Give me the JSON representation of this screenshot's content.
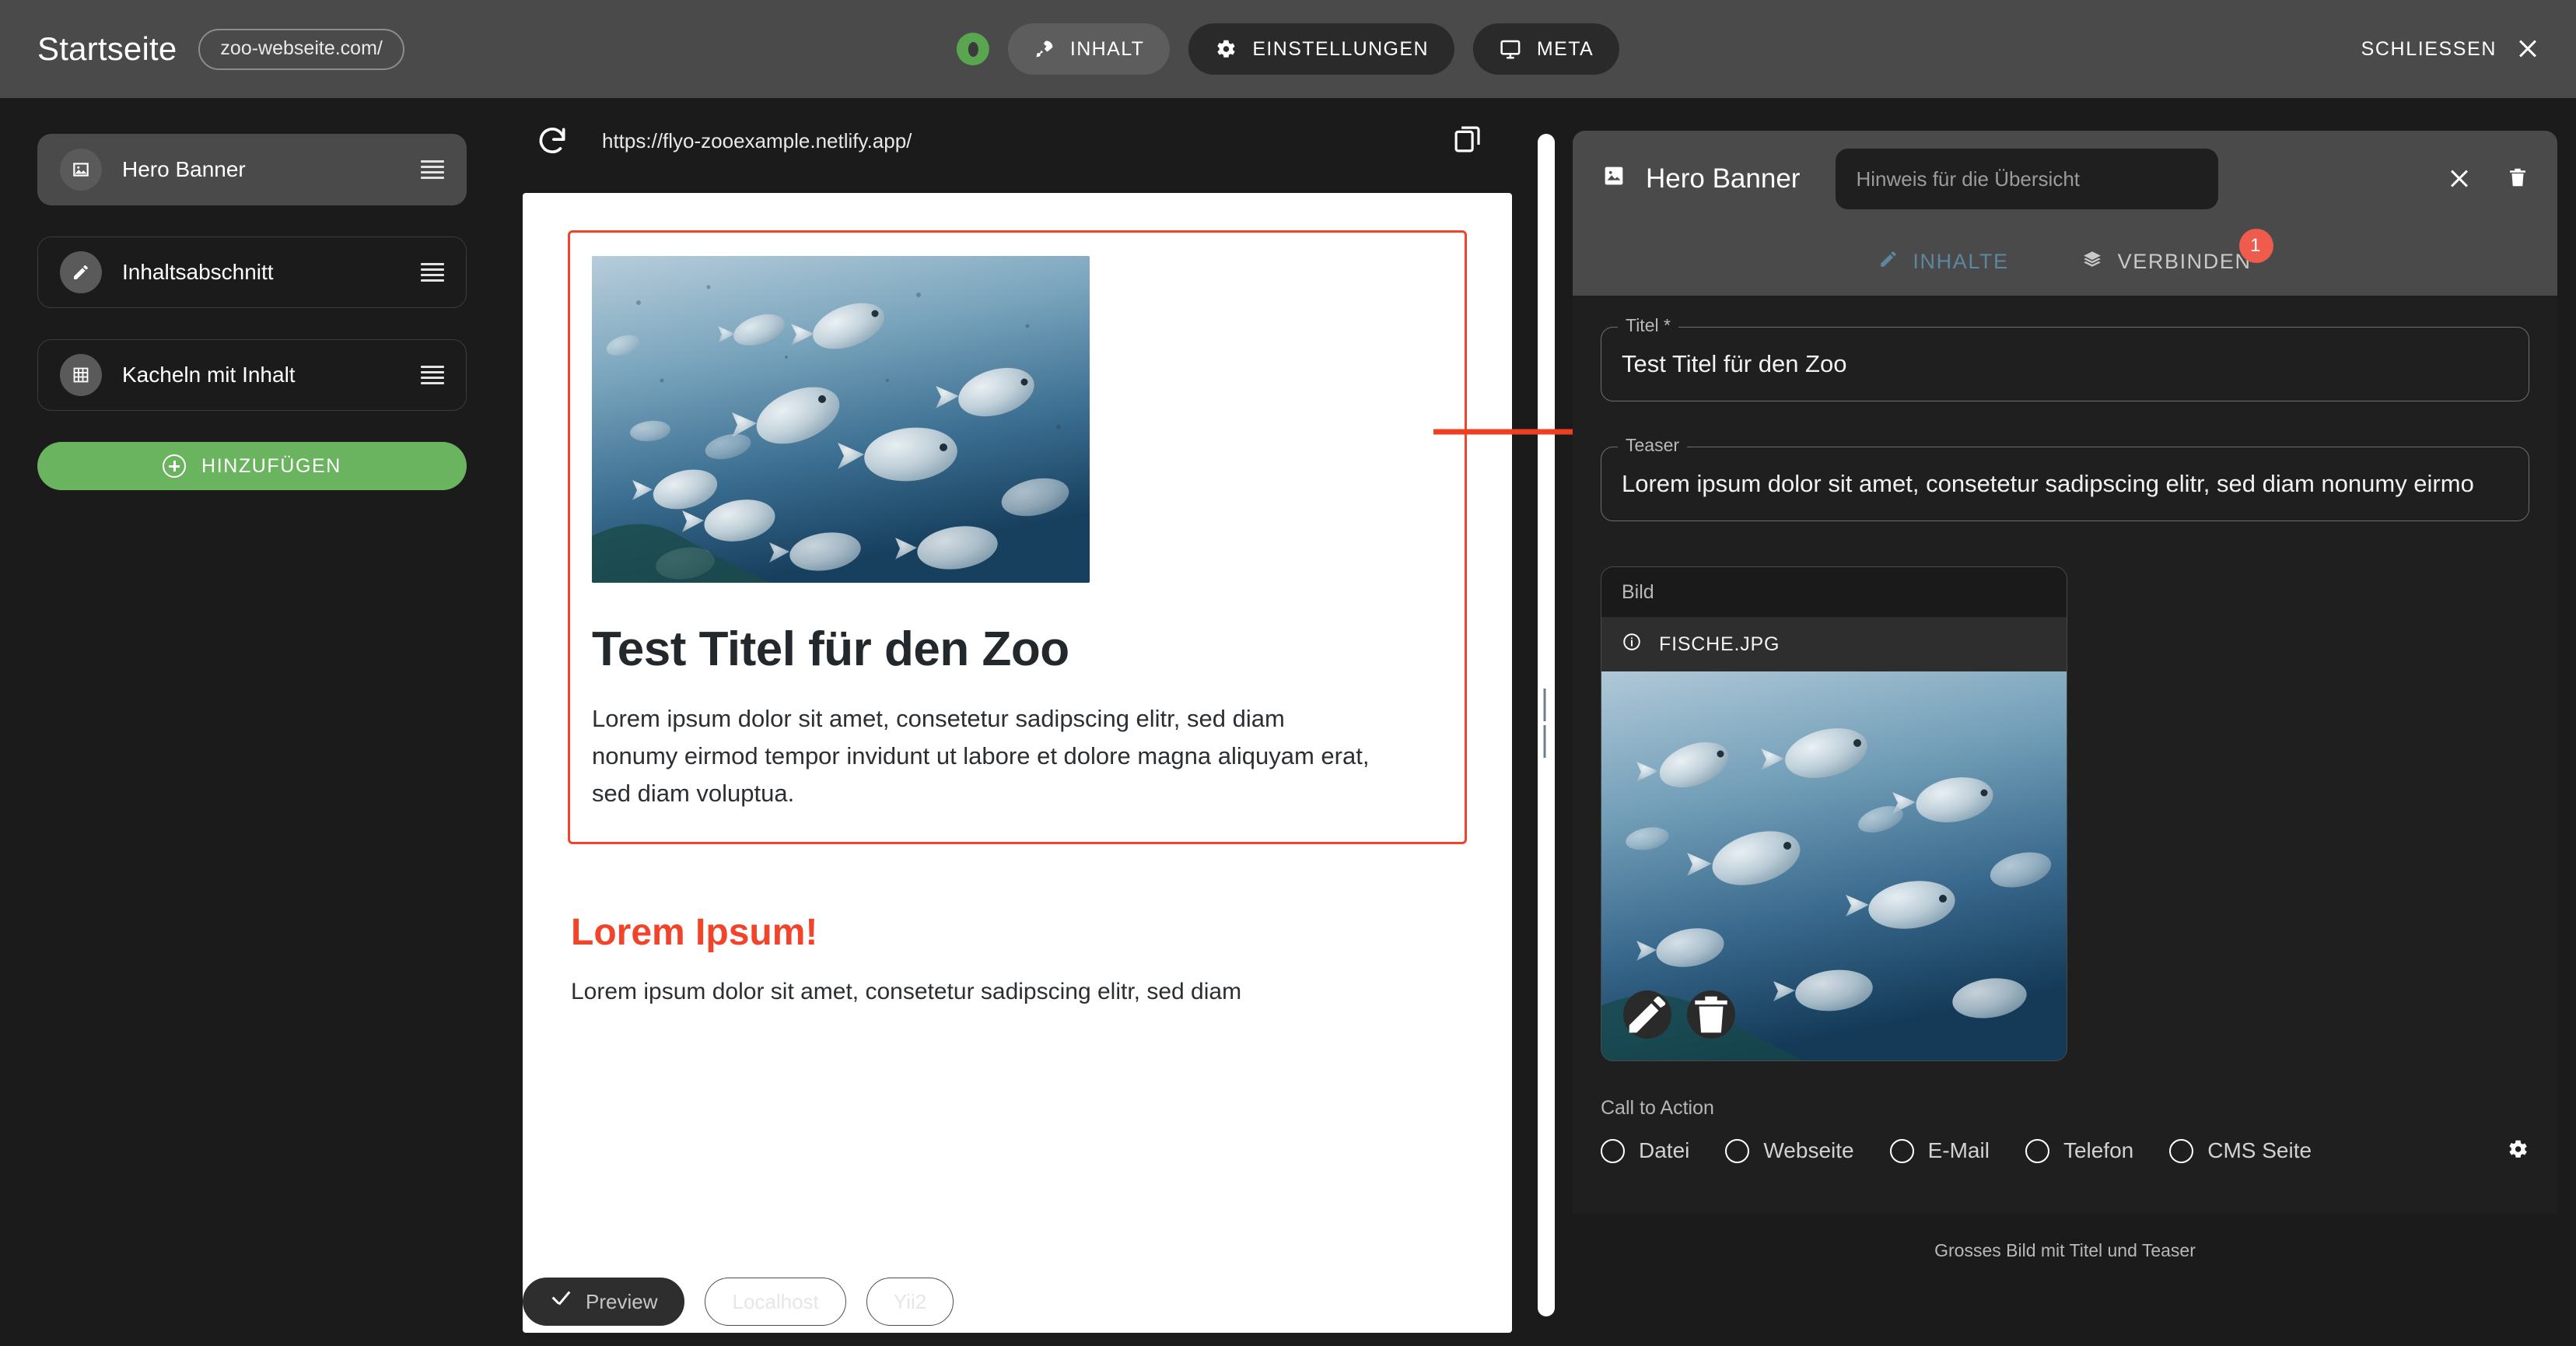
{
  "topbar": {
    "page_title": "Startseite",
    "url_chip": "zoo-webseite.com/",
    "visibility_toggle": "eye-icon",
    "buttons": [
      {
        "label": "INHALT",
        "icon": "rocket-icon",
        "state": "light"
      },
      {
        "label": "EINSTELLUNGEN",
        "icon": "gear-icon",
        "state": "dark"
      },
      {
        "label": "META",
        "icon": "monitor-icon",
        "state": "dark"
      }
    ],
    "close_label": "SCHLIESSEN"
  },
  "sidebar": {
    "items": [
      {
        "label": "Hero Banner",
        "icon": "image-icon",
        "active": true
      },
      {
        "label": "Inhaltsabschnitt",
        "icon": "pencil-icon",
        "active": false
      },
      {
        "label": "Kacheln mit Inhalt",
        "icon": "grid-icon",
        "active": false
      }
    ],
    "add_button": "HINZUFÜGEN"
  },
  "preview": {
    "url": "https://flyo-zooexample.netlify.app/",
    "reload_icon": "reload-icon",
    "copy_icon": "copy-icon",
    "hero": {
      "image_alt": "Schwarm silberner Fische im blauen Wasser",
      "title": "Test Titel für den Zoo",
      "body": "Lorem ipsum dolor sit amet, consetetur sadipscing elitr, sed diam nonumy eirmod tempor invidunt ut labore et dolore magna aliquyam erat, sed diam voluptua."
    },
    "section2": {
      "title": "Lorem Ipsum!",
      "body": "Lorem ipsum dolor sit amet, consetetur sadipscing elitr, sed diam"
    },
    "footer_chips": [
      {
        "label": "Preview",
        "selected": true,
        "icon": "check-icon"
      },
      {
        "label": "Localhost",
        "selected": false
      },
      {
        "label": "Yii2",
        "selected": false
      }
    ]
  },
  "right_panel": {
    "title": "Hero Banner",
    "title_icon": "image-icon",
    "hint_placeholder": "Hinweis für die Übersicht",
    "close_icon": "close-icon",
    "delete_icon": "trash-icon",
    "tabs": [
      {
        "label": "INHALTE",
        "icon": "pencil-icon",
        "active": true,
        "badge": null
      },
      {
        "label": "VERBINDEN",
        "icon": "layers-icon",
        "active": false,
        "badge": "1"
      }
    ],
    "fields": [
      {
        "label": "Titel *",
        "value": "Test Titel für den Zoo"
      },
      {
        "label": "Teaser",
        "value": "Lorem ipsum dolor sit amet, consetetur sadipscing elitr, sed diam nonumy eirmo"
      }
    ],
    "image_block": {
      "label": "Bild",
      "file_name": "FISCHE.JPG",
      "file_icon": "info-icon",
      "edit_icon": "pencil-icon",
      "delete_icon": "trash-icon"
    },
    "cta": {
      "label": "Call to Action",
      "options": [
        "Datei",
        "Webseite",
        "E-Mail",
        "Telefon",
        "CMS Seite"
      ],
      "settings_icon": "gear-icon"
    },
    "footer_note": "Grosses Bild mit Titel und Teaser"
  },
  "annotation": {
    "arrow_color": "#ef3f22"
  },
  "colors": {
    "topbar_bg": "#4a4a4a",
    "app_bg": "#1b1b1b",
    "panel_bg": "#1f1f1f",
    "accent_green": "#6ab35f",
    "accent_red": "#ef5b4c",
    "preview_accent": "#f0452a",
    "tab_active": "#5d87a1"
  }
}
